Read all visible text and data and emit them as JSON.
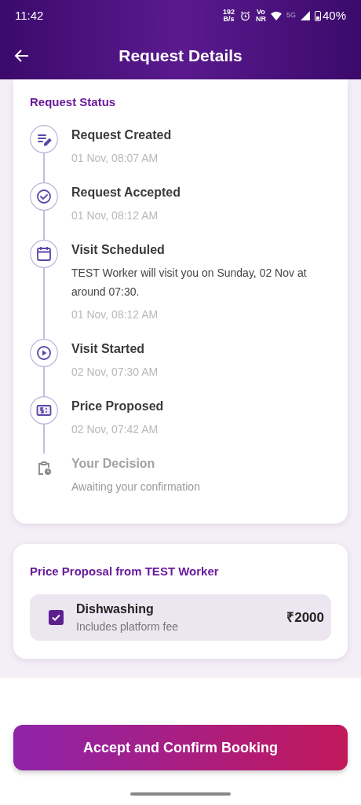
{
  "status_bar": {
    "time": "11:42",
    "speed_value": "192",
    "speed_unit": "B/s",
    "volte_top": "Vo",
    "volte_bottom": "NR",
    "network": "5G",
    "battery": "40%"
  },
  "header": {
    "title": "Request Details"
  },
  "status_card": {
    "title": "Request Status",
    "steps": [
      {
        "kind": "created",
        "title": "Request Created",
        "time": "01 Nov, 08:07 AM",
        "done": true
      },
      {
        "kind": "accepted",
        "title": "Request Accepted",
        "time": "01 Nov, 08:12 AM",
        "done": true
      },
      {
        "kind": "scheduled",
        "title": "Visit Scheduled",
        "note": "TEST Worker will visit you on Sunday, 02 Nov at around 07:30.",
        "time": "01 Nov, 08:12 AM",
        "done": true
      },
      {
        "kind": "started",
        "title": "Visit Started",
        "time": "02 Nov, 07:30 AM",
        "done": true
      },
      {
        "kind": "price",
        "title": "Price Proposed",
        "time": "02 Nov, 07:42 AM",
        "done": true
      },
      {
        "kind": "decision",
        "title": "Your Decision",
        "time": "Awaiting your confirmation",
        "done": false
      }
    ]
  },
  "proposal_card": {
    "title": "Price Proposal from TEST Worker",
    "items": [
      {
        "name": "Dishwashing",
        "note": "Includes platform fee",
        "price": "₹2000",
        "checked": true
      }
    ]
  },
  "footer": {
    "button": "Accept and Confirm Booking"
  }
}
